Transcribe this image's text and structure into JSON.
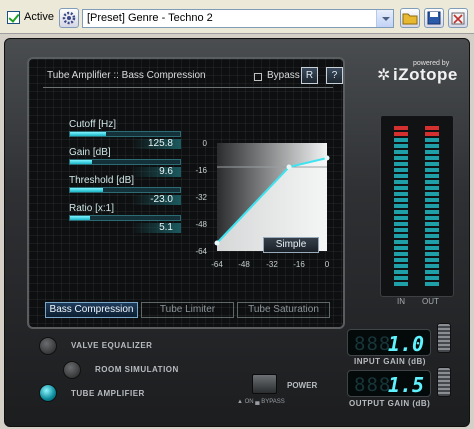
{
  "toolbar": {
    "active_label": "Active",
    "preset_value": "[Preset] Genre - Techno 2"
  },
  "module": {
    "title": "Tube Amplifier :: Bass Compression",
    "bypass_label": "Bypass",
    "reset_label": "R",
    "help_label": "?"
  },
  "params": [
    {
      "label": "Cutoff [Hz]",
      "value": "125.8",
      "fill": 0.33
    },
    {
      "label": "Gain [dB]",
      "value": "9.6",
      "fill": 0.2
    },
    {
      "label": "Threshold [dB]",
      "value": "-23.0",
      "fill": 0.3
    },
    {
      "label": "Ratio [x:1]",
      "value": "5.1",
      "fill": 0.18
    }
  ],
  "graph": {
    "y_ticks": [
      "0",
      "-16",
      "-32",
      "-48",
      "-64"
    ],
    "x_ticks": [
      "-64",
      "-48",
      "-32",
      "-16",
      "0"
    ]
  },
  "simple_label": "Simple",
  "tabs": [
    {
      "label": "Bass Compression",
      "active": true
    },
    {
      "label": "Tube Limiter",
      "active": false
    },
    {
      "label": "Tube Saturation",
      "active": false
    }
  ],
  "brand": {
    "powered_by": "powered by",
    "name": "iZotope"
  },
  "meters": {
    "in_label": "IN",
    "out_label": "OUT"
  },
  "modules": [
    {
      "label": "VALVE EQUALIZER",
      "lit": false
    },
    {
      "label": "ROOM SIMULATION",
      "lit": false
    },
    {
      "label": "TUBE AMPLIFIER",
      "lit": true
    }
  ],
  "power": {
    "label": "POWER",
    "on_bypass": "▲ ON  ▄ BYPASS"
  },
  "input_gain": {
    "ghost": "888",
    "value": "1.0",
    "label": "INPUT GAIN (dB)"
  },
  "output_gain": {
    "ghost": "888",
    "value": "1.5",
    "label": "OUTPUT GAIN (dB)"
  },
  "colors": {
    "accent": "#5ff3ff",
    "meter_green": "#1fa0a8",
    "meter_red": "#d43030"
  }
}
